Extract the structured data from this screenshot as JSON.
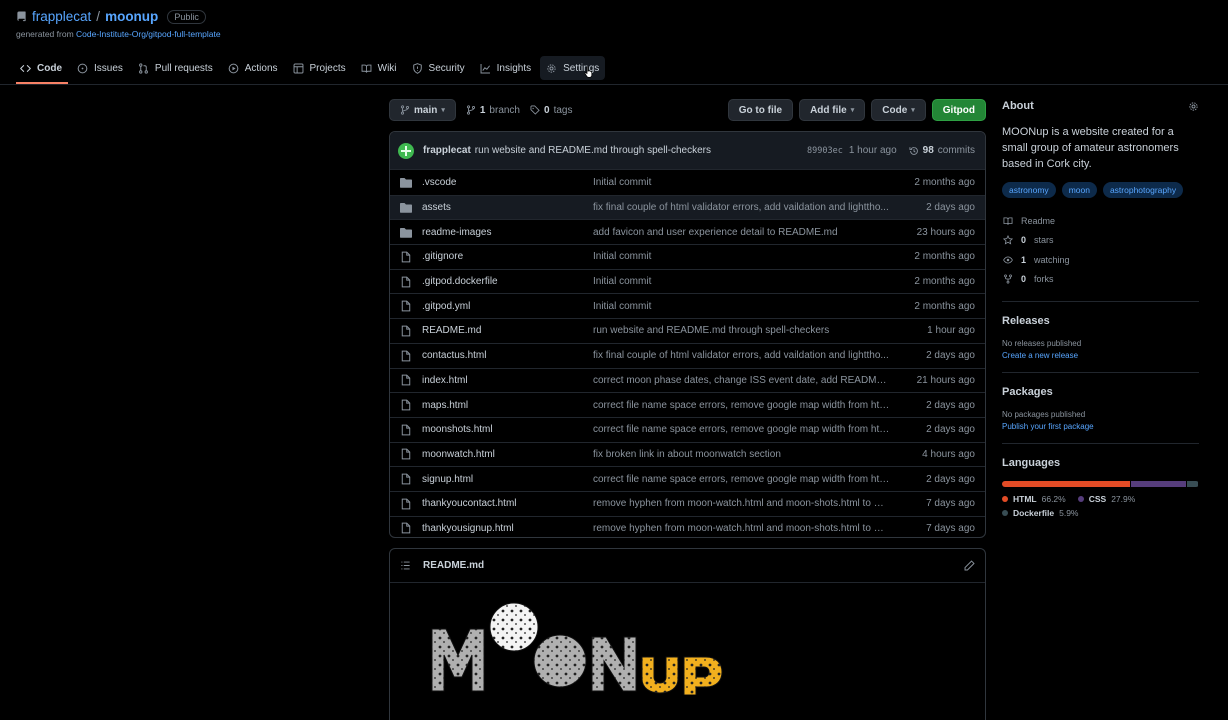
{
  "repo": {
    "owner": "frapplecat",
    "separator": "/",
    "name": "moonup",
    "visibility": "Public",
    "generated_prefix": "generated from",
    "template": "Code-Institute-Org/gitpod-full-template"
  },
  "tabs": [
    {
      "label": "Code",
      "icon": "code-icon",
      "selected": true
    },
    {
      "label": "Issues",
      "icon": "issue-icon"
    },
    {
      "label": "Pull requests",
      "icon": "pull-request-icon"
    },
    {
      "label": "Actions",
      "icon": "play-icon"
    },
    {
      "label": "Projects",
      "icon": "table-icon"
    },
    {
      "label": "Wiki",
      "icon": "book-icon"
    },
    {
      "label": "Security",
      "icon": "shield-icon"
    },
    {
      "label": "Insights",
      "icon": "graph-icon"
    },
    {
      "label": "Settings",
      "icon": "gear-icon",
      "hovered": true
    }
  ],
  "toolbar": {
    "branch": "main",
    "branches_count": "1",
    "branches_label": "branch",
    "tags_count": "0",
    "tags_label": "tags",
    "go_to_file": "Go to file",
    "add_file": "Add file",
    "code": "Code",
    "gitpod": "Gitpod"
  },
  "commit": {
    "author": "frapplecat",
    "message": "run website and README.md through spell-checkers",
    "sha": "89903ec",
    "time": "1 hour ago",
    "count": "98",
    "count_label": "commits"
  },
  "files": [
    {
      "type": "dir",
      "name": ".vscode",
      "message": "Initial commit",
      "age": "2 months ago"
    },
    {
      "type": "dir",
      "name": "assets",
      "message": "fix final couple of html validator errors, add vaildation and lighttho...",
      "age": "2 days ago"
    },
    {
      "type": "dir",
      "name": "readme-images",
      "message": "add favicon and user experience detail to README.md",
      "age": "23 hours ago"
    },
    {
      "type": "file",
      "name": ".gitignore",
      "message": "Initial commit",
      "age": "2 months ago"
    },
    {
      "type": "file",
      "name": ".gitpod.dockerfile",
      "message": "Initial commit",
      "age": "2 months ago"
    },
    {
      "type": "file",
      "name": ".gitpod.yml",
      "message": "Initial commit",
      "age": "2 months ago"
    },
    {
      "type": "file",
      "name": "README.md",
      "message": "run website and README.md through spell-checkers",
      "age": "1 hour ago"
    },
    {
      "type": "file",
      "name": "contactus.html",
      "message": "fix final couple of html validator errors, add vaildation and lighttho...",
      "age": "2 days ago"
    },
    {
      "type": "file",
      "name": "index.html",
      "message": "correct moon phase dates, change ISS event date, add README.md ...",
      "age": "21 hours ago"
    },
    {
      "type": "file",
      "name": "maps.html",
      "message": "correct file name space errors, remove google map width from html ...",
      "age": "2 days ago"
    },
    {
      "type": "file",
      "name": "moonshots.html",
      "message": "correct file name space errors, remove google map width from html ...",
      "age": "2 days ago"
    },
    {
      "type": "file",
      "name": "moonwatch.html",
      "message": "fix broken link in about moonwatch section",
      "age": "4 hours ago"
    },
    {
      "type": "file",
      "name": "signup.html",
      "message": "correct file name space errors, remove google map width from html ...",
      "age": "2 days ago"
    },
    {
      "type": "file",
      "name": "thankyoucontact.html",
      "message": "remove hyphen from moon-watch.html and moon-shots.html to mak...",
      "age": "7 days ago"
    },
    {
      "type": "file",
      "name": "thankyousignup.html",
      "message": "remove hyphen from moon-watch.html and moon-shots.html to mak...",
      "age": "7 days ago"
    }
  ],
  "readme": {
    "title": "README.md",
    "logo_text": "MOONup",
    "logo_colors": {
      "grey": "#b0b0b0",
      "yellow": "#f2b01e"
    }
  },
  "about": {
    "title": "About",
    "description": "MOONup is a website created for a small group of amateur astronomers based in Cork city.",
    "topics": [
      "astronomy",
      "moon",
      "astrophotography"
    ],
    "readme": "Readme",
    "stars_count": "0",
    "stars_label": "stars",
    "watching_count": "1",
    "watching_label": "watching",
    "forks_count": "0",
    "forks_label": "forks"
  },
  "releases": {
    "title": "Releases",
    "note": "No releases published",
    "link": "Create a new release"
  },
  "packages": {
    "title": "Packages",
    "note": "No packages published",
    "link": "Publish your first package"
  },
  "languages": {
    "title": "Languages",
    "items": [
      {
        "name": "HTML",
        "percent": "66.2%",
        "value": 66.2,
        "color": "#e34c26"
      },
      {
        "name": "CSS",
        "percent": "27.9%",
        "value": 27.9,
        "color": "#563d7c"
      },
      {
        "name": "Dockerfile",
        "percent": "5.9%",
        "value": 5.9,
        "color": "#384d54"
      }
    ]
  }
}
